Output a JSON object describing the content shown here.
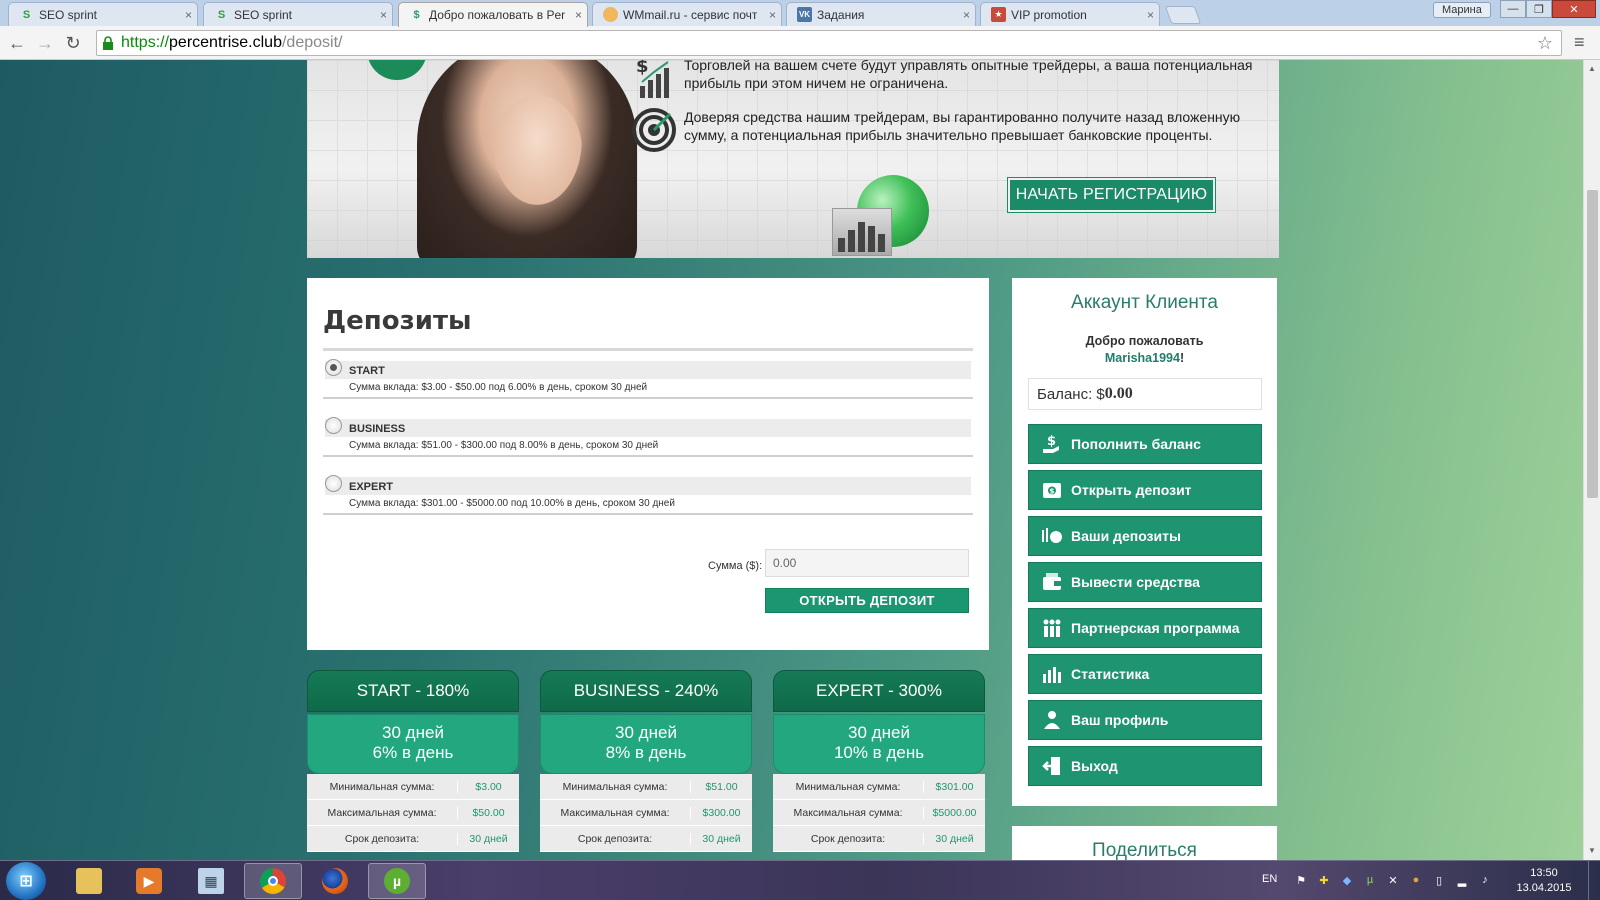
{
  "browser": {
    "tabs": [
      {
        "title": "SEO sprint",
        "icon": "seosprint-icon",
        "active": false
      },
      {
        "title": "SEO sprint",
        "icon": "seosprint-icon",
        "active": false
      },
      {
        "title": "Добро пожаловать в Per",
        "icon": "dollar-icon",
        "active": true
      },
      {
        "title": "WMmail.ru - сервис почт",
        "icon": "wmmail-icon",
        "active": false
      },
      {
        "title": "Задания",
        "icon": "vk-icon",
        "active": false
      },
      {
        "title": "VIP promotion",
        "icon": "vip-icon",
        "active": false
      }
    ],
    "close_glyph": "×",
    "user_name": "Марина",
    "url": {
      "scheme": "https://",
      "host": "percentrise.club",
      "path": "/deposit/"
    }
  },
  "banner": {
    "feature1": "Торговлей на вашем счете будут управлять опытные трейдеры, а ваша потенциальная прибыль при этом ничем не ограничена.",
    "feature2": "Доверяя средства нашим трейдерам, вы гарантированно получите назад вложенную сумму, а потенциальная прибыль значительно превышает банковские проценты.",
    "register_button": "НАЧАТЬ РЕГИСТРАЦИЮ"
  },
  "deposits": {
    "title": "Депозиты",
    "plans": [
      {
        "name": "START",
        "desc": "Сумма вклада: $3.00 - $50.00 под 6.00% в день, сроком 30 дней",
        "selected": true
      },
      {
        "name": "BUSINESS",
        "desc": "Сумма вклада: $51.00 - $300.00 под 8.00% в день, сроком 30 дней",
        "selected": false
      },
      {
        "name": "EXPERT",
        "desc": "Сумма вклада: $301.00 - $5000.00 под 10.00% в день, сроком 30 дней",
        "selected": false
      }
    ],
    "amount_label": "Сумма ($):",
    "amount_value": "0.00",
    "open_button": "ОТКРЫТЬ ДЕПОЗИТ"
  },
  "cards": [
    {
      "title": "START - 180%",
      "line1": "30 дней",
      "line2": "6% в день",
      "min_label": "Минимальная сумма:",
      "min": "$3.00",
      "max_label": "Максимальная сумма:",
      "max": "$50.00",
      "term_label": "Срок депозита:",
      "term": "30 дней"
    },
    {
      "title": "BUSINESS - 240%",
      "line1": "30 дней",
      "line2": "8% в день",
      "min_label": "Минимальная сумма:",
      "min": "$51.00",
      "max_label": "Максимальная сумма:",
      "max": "$300.00",
      "term_label": "Срок депозита:",
      "term": "30 дней"
    },
    {
      "title": "EXPERT - 300%",
      "line1": "30 дней",
      "line2": "10% в день",
      "min_label": "Минимальная сумма:",
      "min": "$301.00",
      "max_label": "Максимальная сумма:",
      "max": "$5000.00",
      "term_label": "Срок депозита:",
      "term": "30 дней"
    }
  ],
  "account": {
    "title": "Аккаунт Клиента",
    "welcome": "Добро пожаловать",
    "username": "Marisha1994",
    "username_suffix": "!",
    "balance_label": "Баланс: $",
    "balance_value": "0.00",
    "menu": [
      {
        "label": "Пополнить баланс",
        "icon": "dollar-hand-icon"
      },
      {
        "label": "Открыть депозит",
        "icon": "safe-icon"
      },
      {
        "label": "Ваши депозиты",
        "icon": "piggy-icon"
      },
      {
        "label": "Вывести средства",
        "icon": "wallet-icon"
      },
      {
        "label": "Партнерская программа",
        "icon": "people-icon"
      },
      {
        "label": "Статистика",
        "icon": "bars-icon"
      },
      {
        "label": "Ваш профиль",
        "icon": "user-icon"
      },
      {
        "label": "Выход",
        "icon": "exit-icon"
      }
    ],
    "share_title": "Поделиться"
  },
  "taskbar": {
    "lang": "EN",
    "time": "13:50",
    "date": "13.04.2015"
  },
  "colors": {
    "brand_green": "#1f9470",
    "card_header": "#157a56",
    "accent_text": "#1a9a6e"
  }
}
